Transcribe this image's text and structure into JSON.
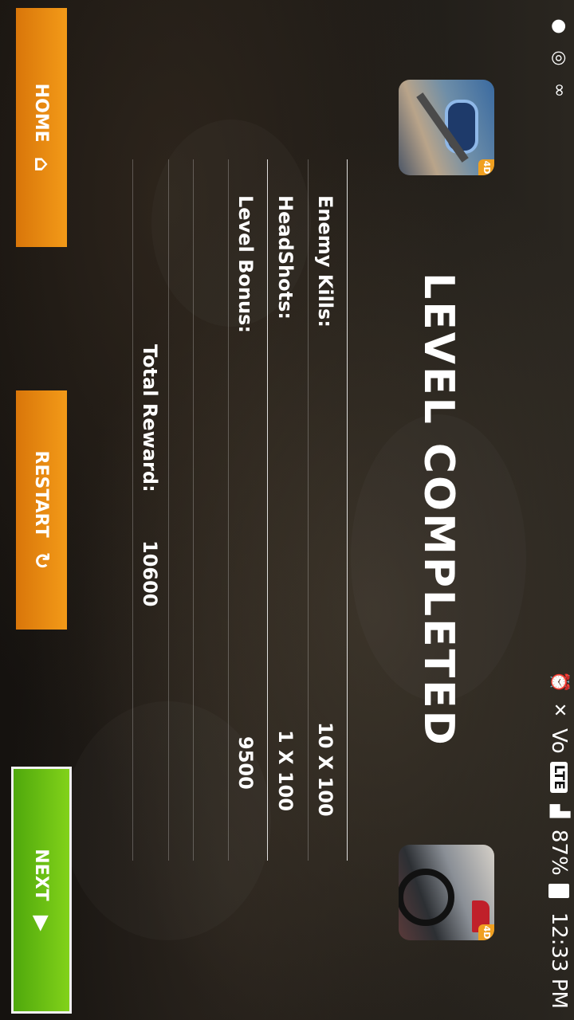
{
  "status_bar": {
    "time": "12:33 PM",
    "battery": "87%",
    "network": "LTE",
    "carrier_prefix": "Vo",
    "icons": [
      "alarm-icon",
      "mute-icon",
      "signal-icon",
      "battery-icon",
      "voicemail-icon",
      "sync-icon",
      "notification-icon"
    ]
  },
  "title": "LEVEL  COMPLETED",
  "stats": [
    {
      "label": "Enemy Kills:",
      "value": "10 X 100"
    },
    {
      "label": "HeadShots:",
      "value": "1 X 100"
    },
    {
      "label": "Level Bonus:",
      "value": "9500"
    }
  ],
  "total": {
    "label": "Total Reward:",
    "value": "10600"
  },
  "ads": {
    "left_badge": "4D",
    "right_badge": "4D"
  },
  "buttons": {
    "home": "HOME",
    "restart": "RESTART",
    "next": "NEXT"
  },
  "colors": {
    "orange_button": "#e8840f",
    "green_button": "#6cc012",
    "text": "#ffffff"
  }
}
